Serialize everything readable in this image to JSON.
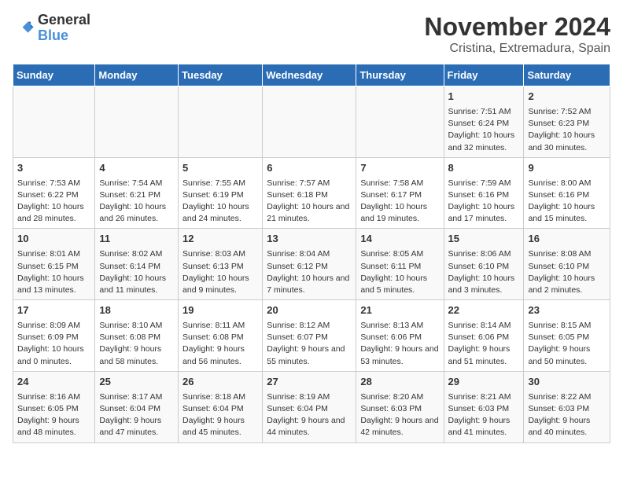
{
  "logo": {
    "line1": "General",
    "line2": "Blue"
  },
  "header": {
    "month": "November 2024",
    "location": "Cristina, Extremadura, Spain"
  },
  "columns": [
    "Sunday",
    "Monday",
    "Tuesday",
    "Wednesday",
    "Thursday",
    "Friday",
    "Saturday"
  ],
  "weeks": [
    [
      {
        "day": "",
        "info": ""
      },
      {
        "day": "",
        "info": ""
      },
      {
        "day": "",
        "info": ""
      },
      {
        "day": "",
        "info": ""
      },
      {
        "day": "",
        "info": ""
      },
      {
        "day": "1",
        "info": "Sunrise: 7:51 AM\nSunset: 6:24 PM\nDaylight: 10 hours and 32 minutes."
      },
      {
        "day": "2",
        "info": "Sunrise: 7:52 AM\nSunset: 6:23 PM\nDaylight: 10 hours and 30 minutes."
      }
    ],
    [
      {
        "day": "3",
        "info": "Sunrise: 7:53 AM\nSunset: 6:22 PM\nDaylight: 10 hours and 28 minutes."
      },
      {
        "day": "4",
        "info": "Sunrise: 7:54 AM\nSunset: 6:21 PM\nDaylight: 10 hours and 26 minutes."
      },
      {
        "day": "5",
        "info": "Sunrise: 7:55 AM\nSunset: 6:19 PM\nDaylight: 10 hours and 24 minutes."
      },
      {
        "day": "6",
        "info": "Sunrise: 7:57 AM\nSunset: 6:18 PM\nDaylight: 10 hours and 21 minutes."
      },
      {
        "day": "7",
        "info": "Sunrise: 7:58 AM\nSunset: 6:17 PM\nDaylight: 10 hours and 19 minutes."
      },
      {
        "day": "8",
        "info": "Sunrise: 7:59 AM\nSunset: 6:16 PM\nDaylight: 10 hours and 17 minutes."
      },
      {
        "day": "9",
        "info": "Sunrise: 8:00 AM\nSunset: 6:16 PM\nDaylight: 10 hours and 15 minutes."
      }
    ],
    [
      {
        "day": "10",
        "info": "Sunrise: 8:01 AM\nSunset: 6:15 PM\nDaylight: 10 hours and 13 minutes."
      },
      {
        "day": "11",
        "info": "Sunrise: 8:02 AM\nSunset: 6:14 PM\nDaylight: 10 hours and 11 minutes."
      },
      {
        "day": "12",
        "info": "Sunrise: 8:03 AM\nSunset: 6:13 PM\nDaylight: 10 hours and 9 minutes."
      },
      {
        "day": "13",
        "info": "Sunrise: 8:04 AM\nSunset: 6:12 PM\nDaylight: 10 hours and 7 minutes."
      },
      {
        "day": "14",
        "info": "Sunrise: 8:05 AM\nSunset: 6:11 PM\nDaylight: 10 hours and 5 minutes."
      },
      {
        "day": "15",
        "info": "Sunrise: 8:06 AM\nSunset: 6:10 PM\nDaylight: 10 hours and 3 minutes."
      },
      {
        "day": "16",
        "info": "Sunrise: 8:08 AM\nSunset: 6:10 PM\nDaylight: 10 hours and 2 minutes."
      }
    ],
    [
      {
        "day": "17",
        "info": "Sunrise: 8:09 AM\nSunset: 6:09 PM\nDaylight: 10 hours and 0 minutes."
      },
      {
        "day": "18",
        "info": "Sunrise: 8:10 AM\nSunset: 6:08 PM\nDaylight: 9 hours and 58 minutes."
      },
      {
        "day": "19",
        "info": "Sunrise: 8:11 AM\nSunset: 6:08 PM\nDaylight: 9 hours and 56 minutes."
      },
      {
        "day": "20",
        "info": "Sunrise: 8:12 AM\nSunset: 6:07 PM\nDaylight: 9 hours and 55 minutes."
      },
      {
        "day": "21",
        "info": "Sunrise: 8:13 AM\nSunset: 6:06 PM\nDaylight: 9 hours and 53 minutes."
      },
      {
        "day": "22",
        "info": "Sunrise: 8:14 AM\nSunset: 6:06 PM\nDaylight: 9 hours and 51 minutes."
      },
      {
        "day": "23",
        "info": "Sunrise: 8:15 AM\nSunset: 6:05 PM\nDaylight: 9 hours and 50 minutes."
      }
    ],
    [
      {
        "day": "24",
        "info": "Sunrise: 8:16 AM\nSunset: 6:05 PM\nDaylight: 9 hours and 48 minutes."
      },
      {
        "day": "25",
        "info": "Sunrise: 8:17 AM\nSunset: 6:04 PM\nDaylight: 9 hours and 47 minutes."
      },
      {
        "day": "26",
        "info": "Sunrise: 8:18 AM\nSunset: 6:04 PM\nDaylight: 9 hours and 45 minutes."
      },
      {
        "day": "27",
        "info": "Sunrise: 8:19 AM\nSunset: 6:04 PM\nDaylight: 9 hours and 44 minutes."
      },
      {
        "day": "28",
        "info": "Sunrise: 8:20 AM\nSunset: 6:03 PM\nDaylight: 9 hours and 42 minutes."
      },
      {
        "day": "29",
        "info": "Sunrise: 8:21 AM\nSunset: 6:03 PM\nDaylight: 9 hours and 41 minutes."
      },
      {
        "day": "30",
        "info": "Sunrise: 8:22 AM\nSunset: 6:03 PM\nDaylight: 9 hours and 40 minutes."
      }
    ]
  ]
}
